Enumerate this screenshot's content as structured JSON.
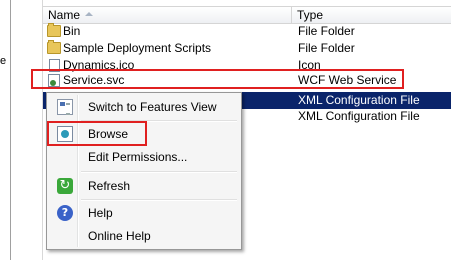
{
  "left_pane": {
    "stub_text": "e"
  },
  "columns": {
    "name": "Name",
    "type": "Type"
  },
  "files": [
    {
      "name": "Bin",
      "type": "File Folder",
      "icon": "folder-icon"
    },
    {
      "name": "Sample Deployment Scripts",
      "type": "File Folder",
      "icon": "folder-icon"
    },
    {
      "name": "Dynamics.ico",
      "type": "Icon",
      "icon": "file-icon"
    },
    {
      "name": "Service.svc",
      "type": "WCF Web Service",
      "icon": "service-file-icon"
    },
    {
      "name": "",
      "type": "XML Configuration File",
      "icon": "config-file-icon",
      "selected": true
    },
    {
      "name": "",
      "type": "XML Configuration File",
      "icon": "config-file-icon"
    }
  ],
  "context_menu": {
    "items": [
      {
        "label": "Switch to Features View",
        "icon": "features-view-icon"
      },
      {
        "label": "Browse",
        "icon": "browse-icon"
      },
      {
        "label": "Edit Permissions...",
        "icon": ""
      },
      {
        "label": "Refresh",
        "icon": "refresh-icon"
      },
      {
        "label": "Help",
        "icon": "help-icon"
      },
      {
        "label": "Online Help",
        "icon": ""
      }
    ],
    "help_glyph": "?"
  },
  "highlight_color": "#e02020",
  "selection_color": "#0a246a"
}
